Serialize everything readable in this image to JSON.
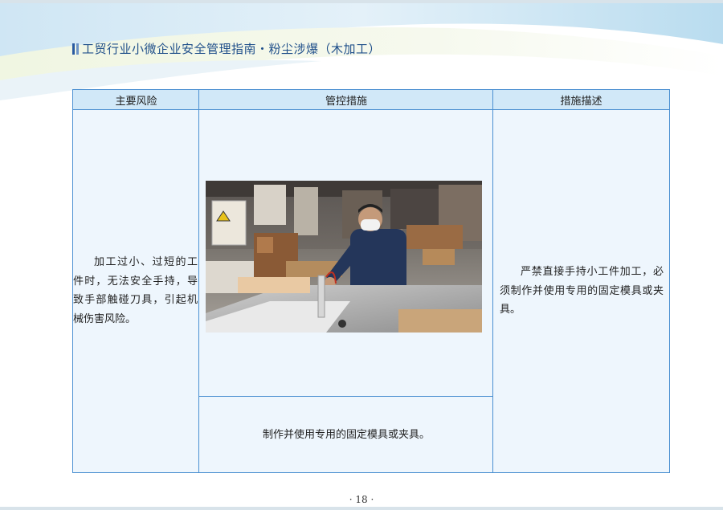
{
  "header": {
    "title": "工贸行业小微企业安全管理指南・粉尘涉爆（木加工）"
  },
  "table": {
    "columns": [
      "主要风险",
      "管控措施",
      "措施描述"
    ],
    "risk": "加工过小、过短的工件时，无法安全手持，导致手部触碰刀具，引起机械伤害风险。",
    "measure": "制作并使用专用的固定模具或夹具。",
    "description": "严禁直接手持小工件加工，必须制作并使用专用的固定模具或夹具。"
  },
  "page_number": "· 18 ·",
  "colors": {
    "border": "#4a8fd1",
    "header_bg": "#d1e8f8",
    "cell_bg": "#eef6fd",
    "title": "#1f4f8a"
  }
}
